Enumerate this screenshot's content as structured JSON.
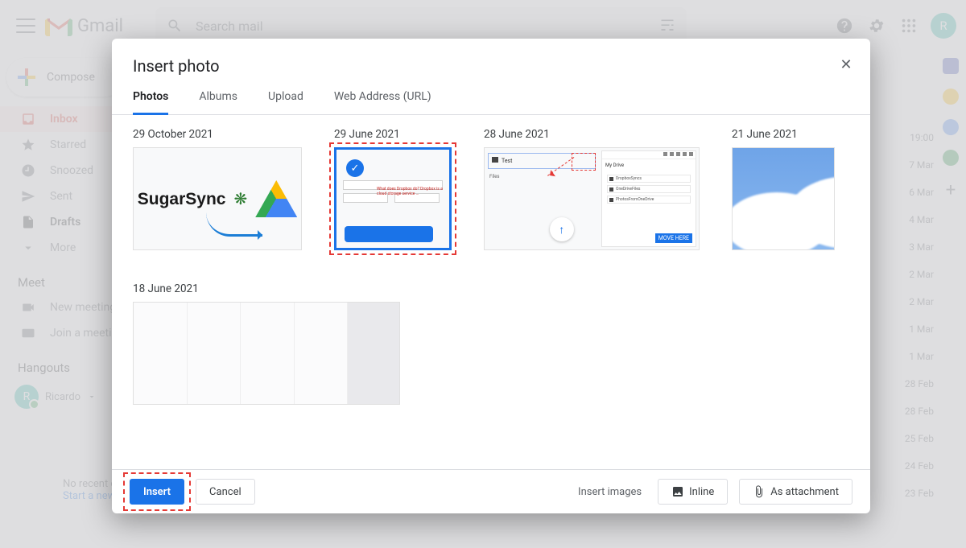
{
  "app": {
    "name": "Gmail",
    "avatar_initial": "R"
  },
  "search": {
    "placeholder": "Search mail"
  },
  "compose_label": "Compose",
  "nav": {
    "inbox": "Inbox",
    "starred": "Starred",
    "snoozed": "Snoozed",
    "sent": "Sent",
    "drafts": "Drafts",
    "more": "More"
  },
  "meet": {
    "header": "Meet",
    "new_meeting": "New meeting",
    "join": "Join a meeting"
  },
  "hangouts": {
    "header": "Hangouts",
    "user": "Ricardo"
  },
  "hint": {
    "line1": "No recent chats",
    "link": "Start a new one"
  },
  "dates_strip": [
    "19:00",
    "7 Mar",
    "6 Mar",
    "4 Mar",
    "3 Mar",
    "2 Mar",
    "2 Mar",
    "1 Mar",
    "1 Mar",
    "28 Feb",
    "28 Feb",
    "25 Feb",
    "24 Feb",
    "23 Feb"
  ],
  "modal": {
    "title": "Insert photo",
    "tabs": {
      "photos": "Photos",
      "albums": "Albums",
      "upload": "Upload",
      "url": "Web Address (URL)"
    },
    "groups": {
      "g1": "29 October 2021",
      "g2": "29 June 2021",
      "g3": "28 June 2021",
      "g4": "21 June 2021",
      "g5": "18 June 2021"
    },
    "thumb1_text": "SugarSync",
    "thumb3": {
      "folder": "Test",
      "section": "Files",
      "side_header": "My Drive",
      "side_items": [
        "DropboxSyncs",
        "OneDriveFiles",
        "PhotosFromOneDrive"
      ],
      "move_here": "MOVE HERE"
    },
    "footer": {
      "insert": "Insert",
      "cancel": "Cancel",
      "insert_images": "Insert images",
      "inline": "Inline",
      "attachment": "As attachment"
    }
  }
}
